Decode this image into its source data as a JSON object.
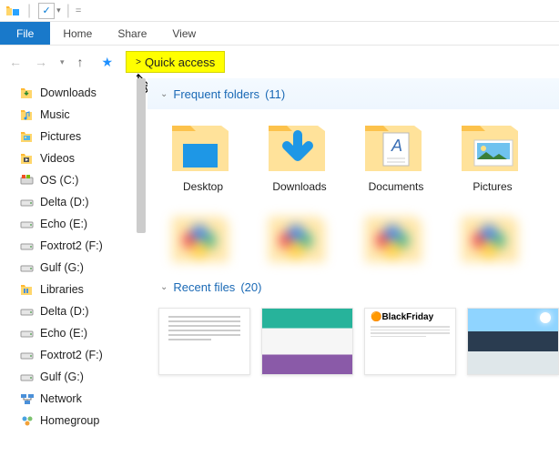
{
  "titlebar": {
    "qa_divider": "|",
    "qa_equals": "="
  },
  "ribbon": {
    "file": "File",
    "tabs": [
      "Home",
      "Share",
      "View"
    ]
  },
  "nav": {
    "back": "←",
    "fwd": "→",
    "up": "↑"
  },
  "breadcrumb": {
    "chevron": ">",
    "label": "Quick access"
  },
  "sidebar": {
    "items": [
      {
        "icon": "download",
        "label": "Downloads"
      },
      {
        "icon": "music",
        "label": "Music"
      },
      {
        "icon": "pictures",
        "label": "Pictures"
      },
      {
        "icon": "videos",
        "label": "Videos"
      },
      {
        "icon": "os",
        "label": "OS (C:)"
      },
      {
        "icon": "drive",
        "label": "Delta (D:)"
      },
      {
        "icon": "drive",
        "label": "Echo (E:)"
      },
      {
        "icon": "drive",
        "label": "Foxtrot2 (F:)"
      },
      {
        "icon": "drive",
        "label": "Gulf (G:)"
      },
      {
        "icon": "libraries",
        "label": "Libraries"
      },
      {
        "icon": "drive",
        "label": "Delta (D:)"
      },
      {
        "icon": "drive",
        "label": "Echo (E:)"
      },
      {
        "icon": "drive",
        "label": "Foxtrot2 (F:)"
      },
      {
        "icon": "drive",
        "label": "Gulf (G:)"
      },
      {
        "icon": "network",
        "label": "Network"
      },
      {
        "icon": "homegroup",
        "label": "Homegroup"
      }
    ]
  },
  "groups": {
    "frequent": {
      "label": "Frequent folders",
      "count": "(11)"
    },
    "recent": {
      "label": "Recent files",
      "count": "(20)"
    }
  },
  "folders": [
    {
      "name": "Desktop",
      "variant": "desktop"
    },
    {
      "name": "Downloads",
      "variant": "downloads"
    },
    {
      "name": "Documents",
      "variant": "documents"
    },
    {
      "name": "Pictures",
      "variant": "pictures"
    }
  ],
  "recent_label": "BlackFriday"
}
